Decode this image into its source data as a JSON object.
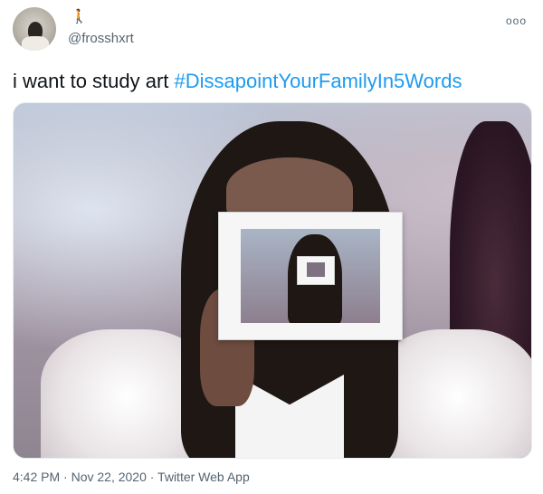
{
  "tweet": {
    "display_name_glyph": "🚶",
    "handle": "@frosshxrt",
    "more_icon": "more-icon",
    "text_plain": "i want to study art ",
    "hashtag": "#DissapointYourFamilyIn5Words",
    "timestamp_line": "4:42 PM · Nov 22, 2020 · Twitter Web App"
  },
  "colors": {
    "hashtag": "#1d9bf0",
    "secondary_text": "#536471"
  }
}
